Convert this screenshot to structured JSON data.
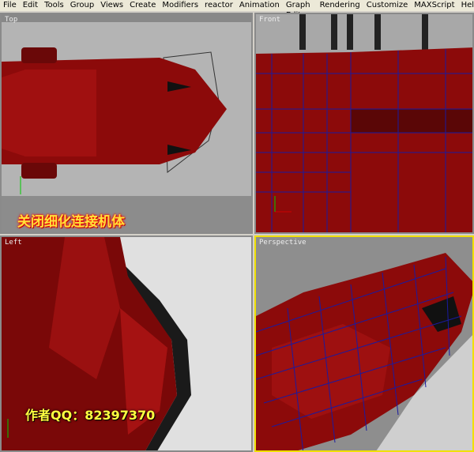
{
  "menu": [
    "File",
    "Edit",
    "Tools",
    "Group",
    "Views",
    "Create",
    "Modifiers",
    "reactor",
    "Animation",
    "Graph Editors",
    "Rendering",
    "Customize",
    "MAXScript",
    "Help"
  ],
  "viewports": {
    "top": "Top",
    "front": "Front",
    "left": "Left",
    "perspective": "Perspective"
  },
  "captions": {
    "top": "关闭细化连接机体",
    "author": "作者QQ：82397370"
  },
  "colors": {
    "model": "#8c0a0a",
    "wire": "#1a1aa0",
    "active_border": "#f0e000"
  }
}
